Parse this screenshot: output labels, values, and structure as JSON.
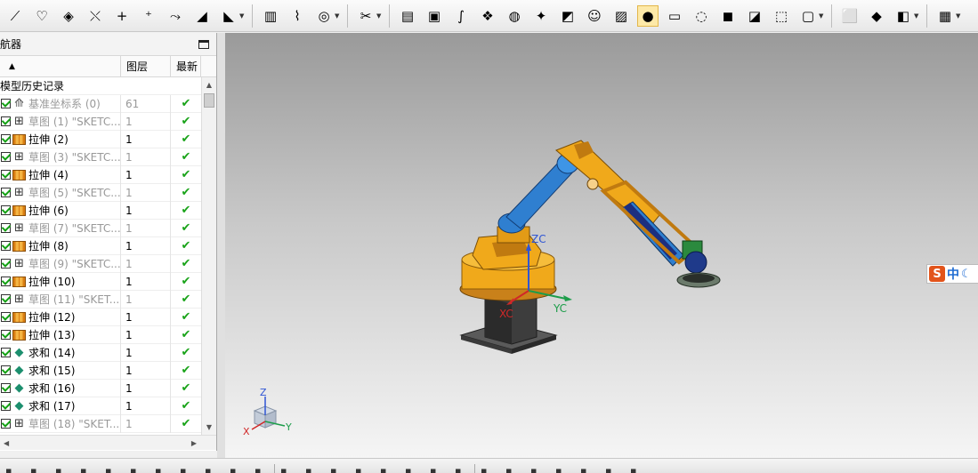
{
  "toolbar": {
    "groups": [
      [
        "polyline-icon",
        "sketch-curve-icon",
        "datum-plane-icon",
        "datum-axis-icon",
        "point-icon",
        "point-set-icon",
        "offset-curve-icon",
        "extrude-face-icon",
        "revolve-face-icon"
      ],
      [
        "cylinder-spring-icon",
        "coil-spring-icon",
        "wheel-icon"
      ],
      [
        "spring-tool-icon"
      ],
      [
        "drawing-sheet-icon",
        "camera-view-icon",
        "edit-curve-icon",
        "palette-icon",
        "render-object-icon",
        "light-icon",
        "highlight-icon",
        "person-icon",
        "scene-icon",
        "color-spheres-icon",
        "display-mode-icon",
        "translucent-icon",
        "box-shaded-icon",
        "shaded-color-icon",
        "wire-box-icon",
        "hidden-box-icon"
      ],
      [
        "frame-select-icon",
        "view-orient-icon",
        "section-view-icon"
      ],
      [
        "document-tools-icon"
      ]
    ],
    "selected_index": 22
  },
  "navigator": {
    "title": "航器",
    "columns": {
      "name": "",
      "layer": "图层",
      "latest": "最新"
    },
    "group_label": "模型历史记录",
    "rows": [
      {
        "type": "datum",
        "name": "基准坐标系 (0)",
        "layer": "61",
        "dim": true
      },
      {
        "type": "sketch",
        "name": "草图 (1) \"SKETC...",
        "layer": "1",
        "dim": true
      },
      {
        "type": "extrude",
        "name": "拉伸 (2)",
        "layer": "1",
        "dim": false
      },
      {
        "type": "sketch",
        "name": "草图 (3) \"SKETC...",
        "layer": "1",
        "dim": true
      },
      {
        "type": "extrude",
        "name": "拉伸 (4)",
        "layer": "1",
        "dim": false
      },
      {
        "type": "sketch",
        "name": "草图 (5) \"SKETC...",
        "layer": "1",
        "dim": true
      },
      {
        "type": "extrude",
        "name": "拉伸 (6)",
        "layer": "1",
        "dim": false
      },
      {
        "type": "sketch",
        "name": "草图 (7) \"SKETC...",
        "layer": "1",
        "dim": true
      },
      {
        "type": "extrude",
        "name": "拉伸 (8)",
        "layer": "1",
        "dim": false
      },
      {
        "type": "sketch",
        "name": "草图 (9) \"SKETC...",
        "layer": "1",
        "dim": true
      },
      {
        "type": "extrude",
        "name": "拉伸 (10)",
        "layer": "1",
        "dim": false
      },
      {
        "type": "sketch",
        "name": "草图 (11) \"SKET...",
        "layer": "1",
        "dim": true
      },
      {
        "type": "extrude",
        "name": "拉伸 (12)",
        "layer": "1",
        "dim": false
      },
      {
        "type": "extrude",
        "name": "拉伸 (13)",
        "layer": "1",
        "dim": false
      },
      {
        "type": "unite",
        "name": "求和 (14)",
        "layer": "1",
        "dim": false
      },
      {
        "type": "unite",
        "name": "求和 (15)",
        "layer": "1",
        "dim": false
      },
      {
        "type": "unite",
        "name": "求和 (16)",
        "layer": "1",
        "dim": false
      },
      {
        "type": "unite",
        "name": "求和 (17)",
        "layer": "1",
        "dim": false
      },
      {
        "type": "sketch",
        "name": "草图 (18) \"SKET...",
        "layer": "1",
        "dim": true
      }
    ]
  },
  "viewport": {
    "model_axes": {
      "z": "ZC",
      "x": "XC",
      "y": "YC"
    },
    "triad_axes": {
      "z": "Z",
      "x": "X",
      "y": "Y"
    }
  },
  "ime": {
    "logo": "S",
    "lang": "中",
    "mode": "☾"
  },
  "colors": {
    "robot_orange": "#f0a91b",
    "robot_blue": "#2f7fd0",
    "base_dark": "#3a3a3a",
    "check_green": "#19a319",
    "axis_z": "#2f55d4",
    "axis_x": "#d02828",
    "axis_y": "#1d9d4a"
  }
}
